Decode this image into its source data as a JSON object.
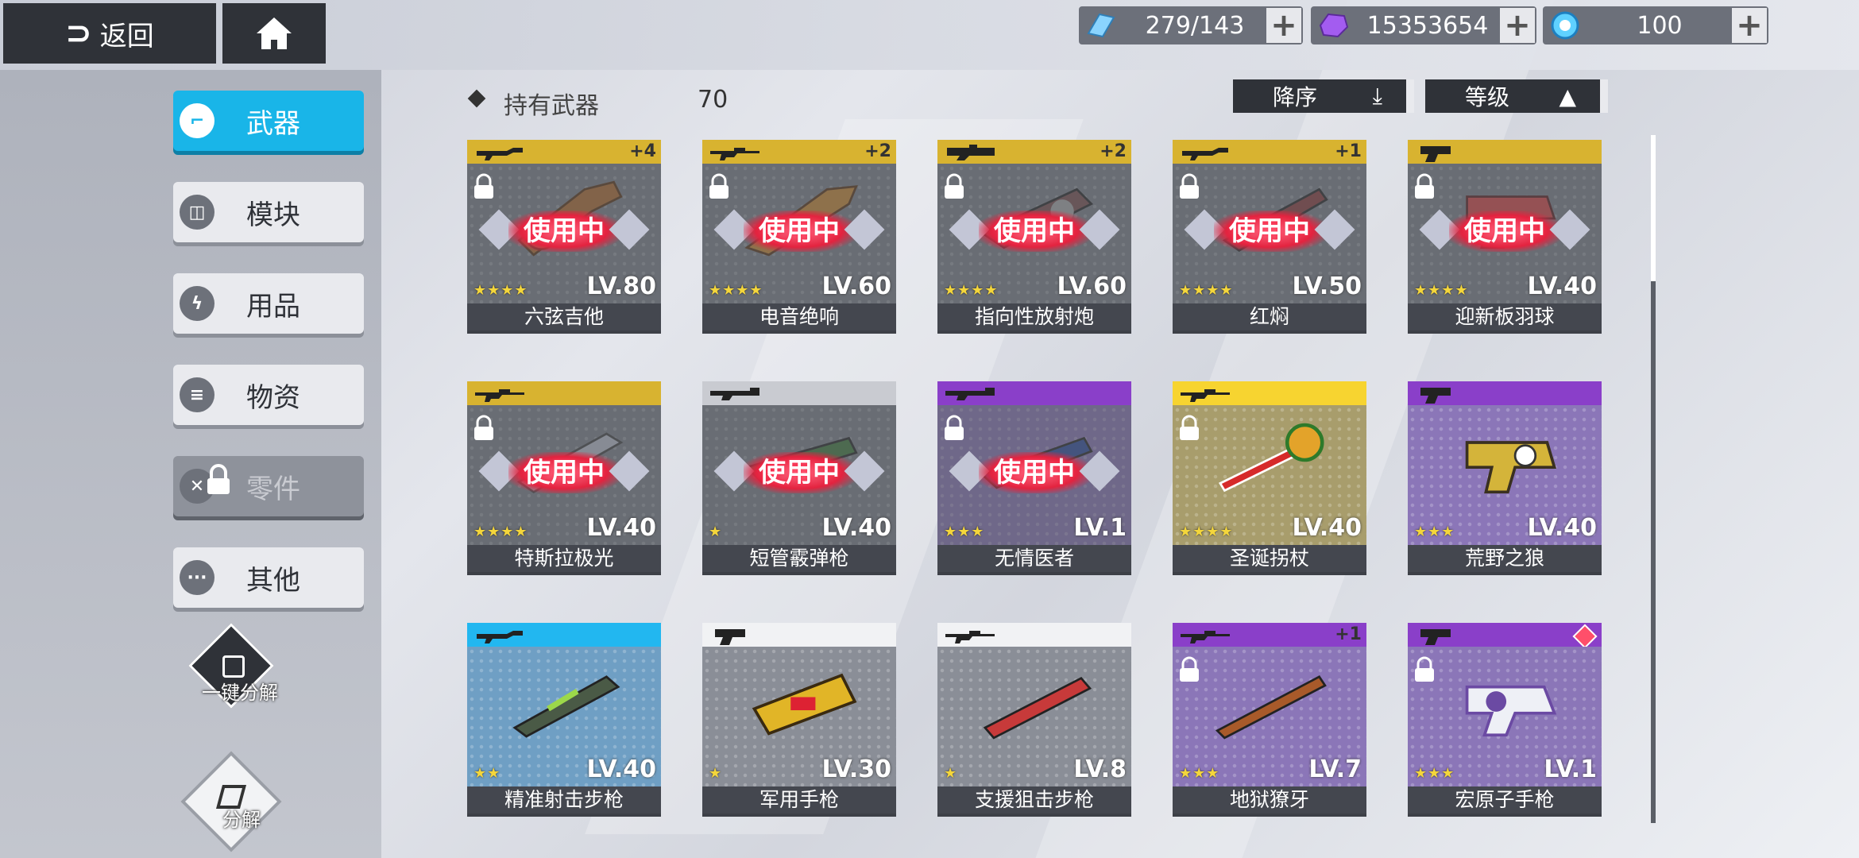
{
  "topbar": {
    "back_label": "返回",
    "resources": [
      {
        "icon": "stamina-icon",
        "value": "279/143"
      },
      {
        "icon": "purple-crystal-icon",
        "value": "15353654"
      },
      {
        "icon": "energy-orb-icon",
        "value": "100"
      }
    ],
    "plus_label": "+"
  },
  "sidebar": {
    "items": [
      {
        "label": "武器",
        "icon": "gun-icon",
        "state": "active"
      },
      {
        "label": "模块",
        "icon": "module-icon",
        "state": "normal"
      },
      {
        "label": "用品",
        "icon": "lightning-icon",
        "state": "normal"
      },
      {
        "label": "物资",
        "icon": "supply-icon",
        "state": "normal"
      },
      {
        "label": "零件",
        "icon": "parts-icon",
        "state": "locked"
      },
      {
        "label": "其他",
        "icon": "more-icon",
        "state": "normal"
      }
    ],
    "quick_dismantle_label": "一键分解",
    "dismantle_label": "分解"
  },
  "header": {
    "title": "持有武器",
    "count": "70",
    "sort_label": "降序",
    "filter_label": "等级"
  },
  "colors": {
    "accent": "#19b5e8",
    "gold": "#d8b330",
    "purple": "#8a3fc9",
    "grey": "#c9cbd1",
    "blue": "#22b7f0",
    "white": "#f1f2f4",
    "yellow": "#f7d430",
    "inuse_red": "#e3233f"
  },
  "in_use_label": "使用中",
  "weapons": [
    {
      "name": "六弦吉他",
      "level": "LV.80",
      "stars": 4,
      "rarity": "gold",
      "plus": "+4",
      "in_use": true,
      "locked": true,
      "type": "rifle"
    },
    {
      "name": "电音绝响",
      "level": "LV.60",
      "stars": 4,
      "rarity": "gold",
      "plus": "+2",
      "in_use": true,
      "locked": true,
      "type": "sniper"
    },
    {
      "name": "指向性放射炮",
      "level": "LV.60",
      "stars": 4,
      "rarity": "gold",
      "plus": "+2",
      "in_use": true,
      "locked": true,
      "type": "cannon"
    },
    {
      "name": "红焖",
      "level": "LV.50",
      "stars": 4,
      "rarity": "gold",
      "plus": "+1",
      "in_use": true,
      "locked": true,
      "type": "rifle"
    },
    {
      "name": "迎新板羽球",
      "level": "LV.40",
      "stars": 4,
      "rarity": "gold",
      "plus": "",
      "in_use": true,
      "locked": true,
      "type": "pistol"
    },
    {
      "name": "特斯拉极光",
      "level": "LV.40",
      "stars": 4,
      "rarity": "gold",
      "plus": "",
      "in_use": true,
      "locked": true,
      "type": "sniper"
    },
    {
      "name": "短管霰弹枪",
      "level": "LV.40",
      "stars": 1,
      "rarity": "grey",
      "plus": "",
      "in_use": true,
      "locked": false,
      "type": "shotgun"
    },
    {
      "name": "无情医者",
      "level": "LV.1",
      "stars": 3,
      "rarity": "purple",
      "plus": "",
      "in_use": true,
      "locked": true,
      "type": "shotgun"
    },
    {
      "name": "圣诞拐杖",
      "level": "LV.40",
      "stars": 4,
      "rarity": "yellow",
      "plus": "",
      "in_use": false,
      "locked": true,
      "type": "sniper"
    },
    {
      "name": "荒野之狼",
      "level": "LV.40",
      "stars": 3,
      "rarity": "purple",
      "plus": "",
      "in_use": false,
      "locked": false,
      "type": "pistol"
    },
    {
      "name": "精准射击步枪",
      "level": "LV.40",
      "stars": 2,
      "rarity": "blue",
      "plus": "",
      "in_use": false,
      "locked": false,
      "type": "rifle"
    },
    {
      "name": "军用手枪",
      "level": "LV.30",
      "stars": 1,
      "rarity": "white",
      "plus": "",
      "in_use": false,
      "locked": false,
      "type": "pistol"
    },
    {
      "name": "支援狙击步枪",
      "level": "LV.8",
      "stars": 1,
      "rarity": "white",
      "plus": "",
      "in_use": false,
      "locked": false,
      "type": "sniper"
    },
    {
      "name": "地狱獠牙",
      "level": "LV.7",
      "stars": 3,
      "rarity": "purple",
      "plus": "+1",
      "in_use": false,
      "locked": true,
      "type": "sniper"
    },
    {
      "name": "宏原子手枪",
      "level": "LV.1",
      "stars": 3,
      "rarity": "purple",
      "plus": "",
      "in_use": false,
      "locked": true,
      "type": "pistol",
      "gem": true
    }
  ]
}
